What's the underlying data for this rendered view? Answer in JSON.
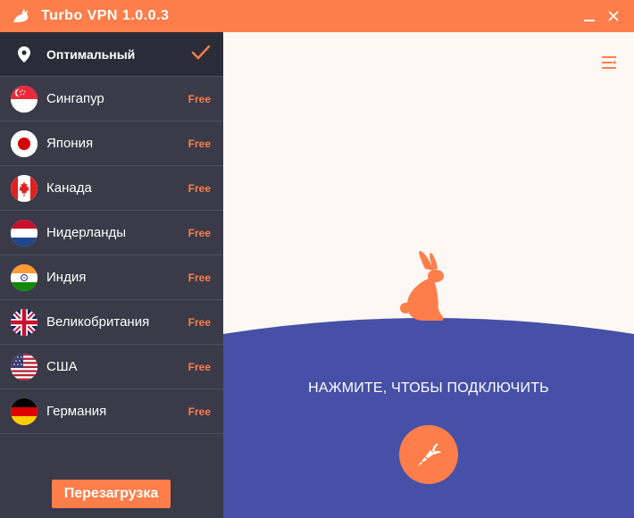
{
  "window": {
    "title": "Turbo VPN  1.0.0.3",
    "accent_color": "#fd7e4a",
    "sidebar_color": "#3a3a48",
    "hill_color": "#4650a6"
  },
  "sidebar": {
    "optimal": {
      "label": "Оптимальный",
      "selected": true,
      "icon": "location-pin-icon"
    },
    "servers": [
      {
        "flag": "singapore-flag-icon",
        "name": "Сингапур",
        "tag": "Free"
      },
      {
        "flag": "japan-flag-icon",
        "name": "Япония",
        "tag": "Free"
      },
      {
        "flag": "canada-flag-icon",
        "name": "Канада",
        "tag": "Free"
      },
      {
        "flag": "netherlands-flag-icon",
        "name": "Нидерланды",
        "tag": "Free"
      },
      {
        "flag": "india-flag-icon",
        "name": "Индия",
        "tag": "Free"
      },
      {
        "flag": "uk-flag-icon",
        "name": "Великобритания",
        "tag": "Free"
      },
      {
        "flag": "usa-flag-icon",
        "name": "США",
        "tag": "Free"
      },
      {
        "flag": "germany-flag-icon",
        "name": "Германия",
        "tag": "Free"
      }
    ],
    "refresh_label": "Перезагрузка"
  },
  "main": {
    "prompt": "НАЖМИТЕ, ЧТОБЫ ПОДКЛЮЧИТЬ",
    "connect_icon": "carrot-icon",
    "menu_icon": "menu-icon"
  }
}
